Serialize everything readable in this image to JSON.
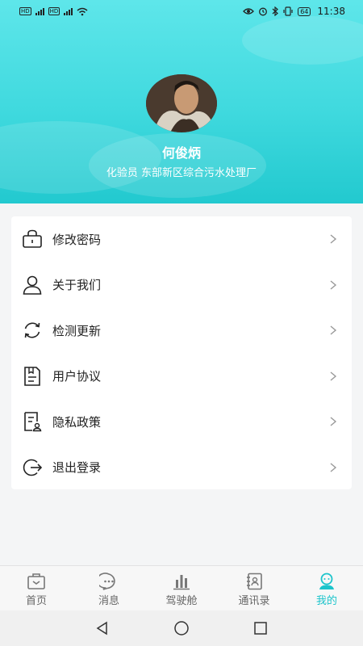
{
  "status_bar": {
    "left_chips": [
      "HD",
      "HD"
    ],
    "time": "11:38",
    "battery": "64"
  },
  "profile": {
    "name": "何俊炳",
    "subtitle": "化验员 东部新区综合污水处理厂"
  },
  "menu": {
    "items": [
      {
        "label": "修改密码",
        "icon": "lock-icon"
      },
      {
        "label": "关于我们",
        "icon": "person-icon"
      },
      {
        "label": "检测更新",
        "icon": "refresh-icon"
      },
      {
        "label": "用户协议",
        "icon": "document-icon"
      },
      {
        "label": "隐私政策",
        "icon": "privacy-document-icon"
      },
      {
        "label": "退出登录",
        "icon": "logout-icon"
      }
    ]
  },
  "tabs": [
    {
      "label": "首页",
      "icon": "home-briefcase-icon",
      "active": false
    },
    {
      "label": "消息",
      "icon": "message-bubble-icon",
      "active": false
    },
    {
      "label": "驾驶舱",
      "icon": "bar-chart-icon",
      "active": false
    },
    {
      "label": "通讯录",
      "icon": "contacts-book-icon",
      "active": false
    },
    {
      "label": "我的",
      "icon": "profile-face-icon",
      "active": true
    }
  ],
  "colors": {
    "accent": "#1cc4cb",
    "header_top": "#5ee6ea",
    "header_bottom": "#22c9cf",
    "text": "#222222",
    "inactive_tab": "#666666"
  }
}
